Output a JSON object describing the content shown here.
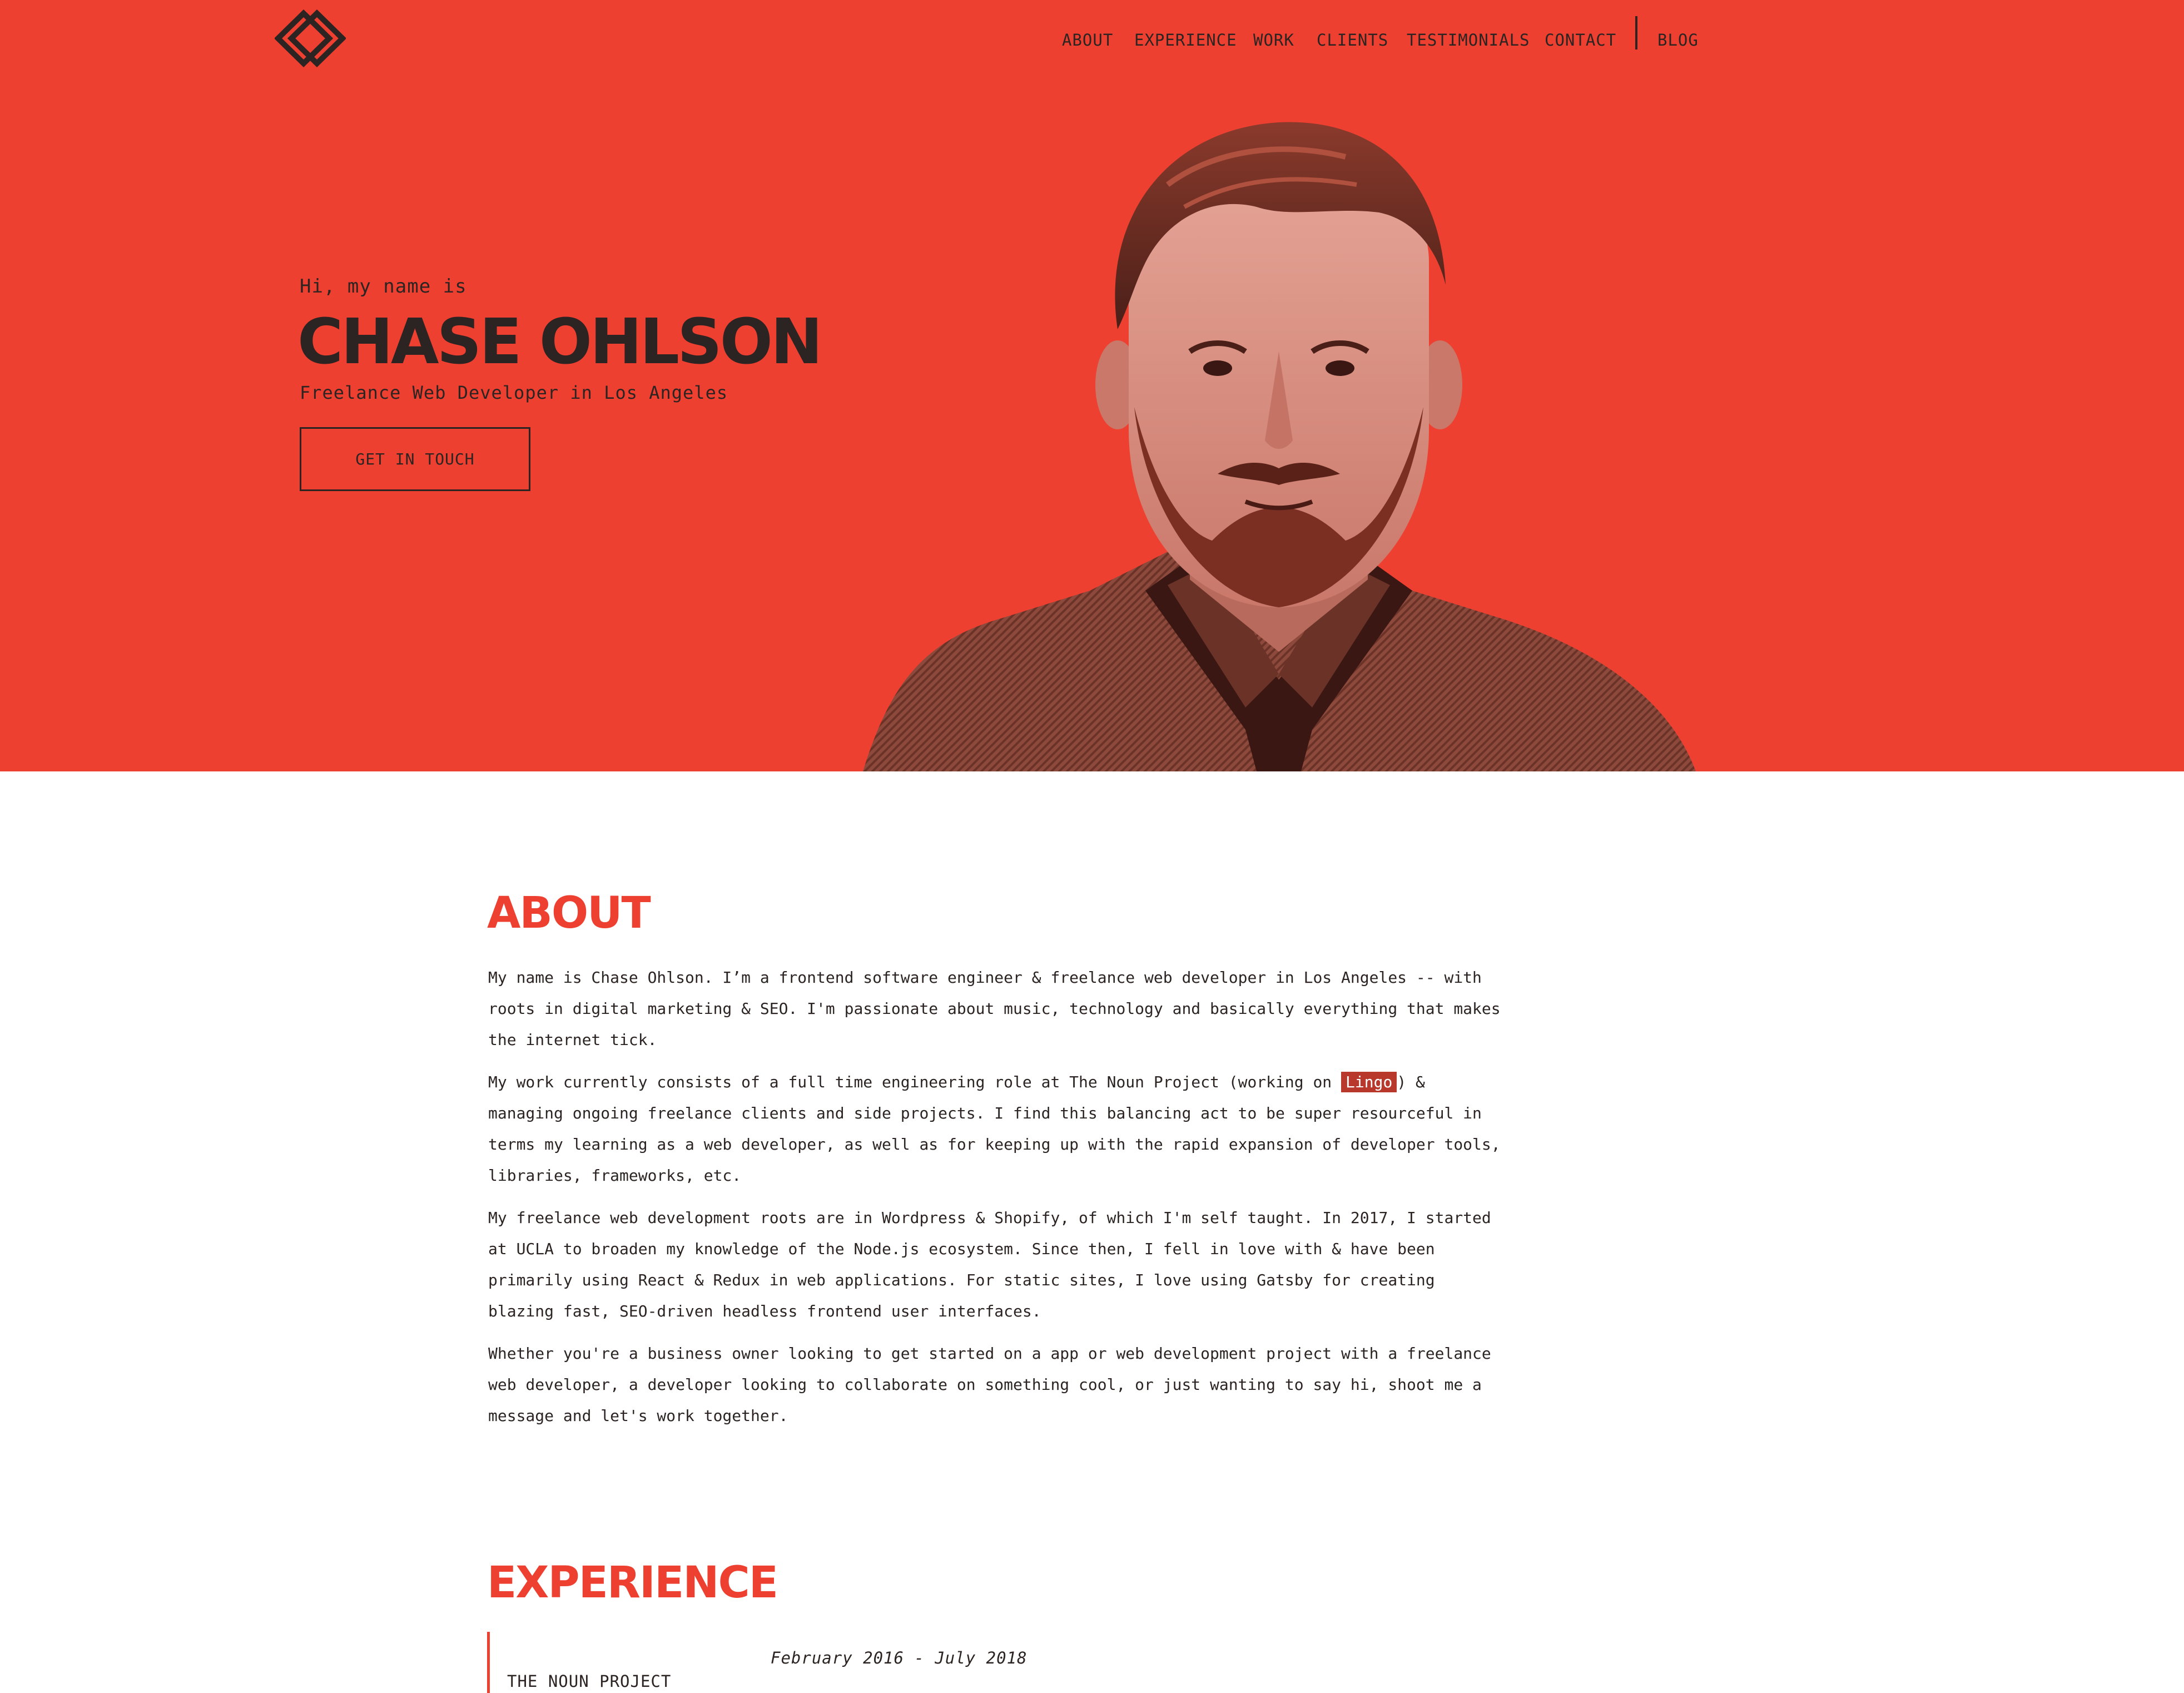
{
  "nav": {
    "items": [
      "ABOUT",
      "EXPERIENCE",
      "WORK",
      "CLIENTS",
      "TESTIMONIALS",
      "CONTACT"
    ],
    "blog": "BLOG"
  },
  "hero": {
    "greeting": "Hi, my name is",
    "name": "CHASE OHLSON",
    "subtitle": "Freelance Web Developer in Los Angeles",
    "cta_label": "GET IN TOUCH"
  },
  "about": {
    "title": "ABOUT",
    "p1": "My name is Chase Ohlson. I’m a frontend software engineer & freelance web developer in Los Angeles -- with roots in digital marketing & SEO. I'm passionate about music, technology and basically everything that makes the internet tick.",
    "p2_before": "My work currently consists of a full time engineering role at The Noun Project (working on ",
    "p2_link": "Lingo",
    "p2_after": ") & managing ongoing freelance clients and side projects. I find this balancing act to be super resourceful in terms my learning as a web developer, as well as for keeping up with the rapid expansion of developer tools, libraries, frameworks, etc.",
    "p3": "My freelance web development roots are in Wordpress & Shopify, of which I'm self taught. In 2017, I started at UCLA to broaden my knowledge of the Node.js ecosystem. Since then, I fell in love with & have been primarily using React & Redux in web applications. For static sites, I love using Gatsby for creating blazing fast, SEO-driven headless frontend user interfaces.",
    "p4": "Whether you're a business owner looking to get started on a app or web development project with a freelance web developer, a developer looking to collaborate on something cool, or just wanting to say hi, shoot me a message and let's work together."
  },
  "experience": {
    "title": "EXPERIENCE",
    "items": [
      {
        "company": "THE NOUN PROJECT",
        "dates": "February 2016 - July 2018"
      }
    ]
  },
  "colors": {
    "accent": "#ee4030",
    "text": "#2b2422",
    "link_highlight": "#b8392c"
  },
  "icons": {
    "logo": "double-diamond-logo-icon"
  }
}
